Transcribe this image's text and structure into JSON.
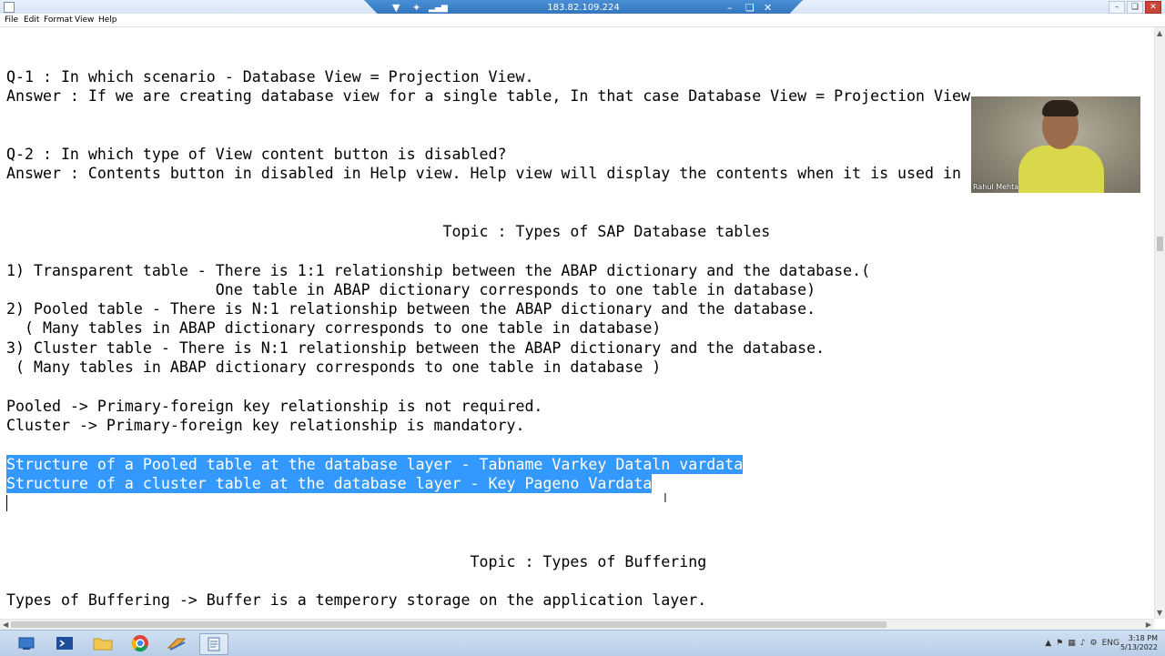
{
  "remote": {
    "host": "183.82.109.224"
  },
  "menu": {
    "items": [
      "File",
      "Edit",
      "Format",
      "View",
      "Help"
    ]
  },
  "editor": {
    "lines": [
      {
        "text": "Q-1 : In which scenario - Database View = Projection View.",
        "selected": false
      },
      {
        "text": "Answer : If we are creating database view for a single table, In that case Database View = Projection View",
        "selected": false
      },
      {
        "text": "Q-2 : In which type of View content button is disabled?",
        "selected": false
      },
      {
        "text": "Answer : Contents button in disabled in Help view. Help view will display the contents when it is used in",
        "selected": false
      },
      {
        "text": "                                                Topic : Types of SAP Database tables",
        "selected": false
      },
      {
        "text": "1) Transparent table - There is 1:1 relationship between the ABAP dictionary and the database.(",
        "selected": false
      },
      {
        "text": "                       One table in ABAP dictionary corresponds to one table in database)",
        "selected": false
      },
      {
        "text": "2) Pooled table - There is N:1 relationship between the ABAP dictionary and the database.",
        "selected": false
      },
      {
        "text": "  ( Many tables in ABAP dictionary corresponds to one table in database)",
        "selected": false
      },
      {
        "text": "3) Cluster table - There is N:1 relationship between the ABAP dictionary and the database.",
        "selected": false
      },
      {
        "text": " ( Many tables in ABAP dictionary corresponds to one table in database )",
        "selected": false
      },
      {
        "text": "Pooled -> Primary-foreign key relationship is not required.",
        "selected": false
      },
      {
        "text": "Cluster -> Primary-foreign key relationship is mandatory.",
        "selected": false
      },
      {
        "text": "Structure of a Pooled table at the database layer - Tabname Varkey Dataln vardata",
        "selected": true
      },
      {
        "text": "Structure of a cluster table at the database layer - Key Pageno Vardata",
        "selected": true
      },
      {
        "text": "                                                   Topic : Types of Buffering",
        "selected": false
      },
      {
        "text": "Types of Buffering -> Buffer is a temperory storage on the application layer.",
        "selected": false
      }
    ]
  },
  "webcam": {
    "name": "Rahul Mehta"
  },
  "tray": {
    "lang": "ENG"
  },
  "clock": {
    "time": "3:18 PM",
    "date": "5/13/2022"
  },
  "taskbar": {
    "apps": [
      "start-icon",
      "powershell-icon",
      "file-explorer-icon",
      "chrome-icon",
      "sap-logon-icon",
      "notepad-icon"
    ]
  }
}
